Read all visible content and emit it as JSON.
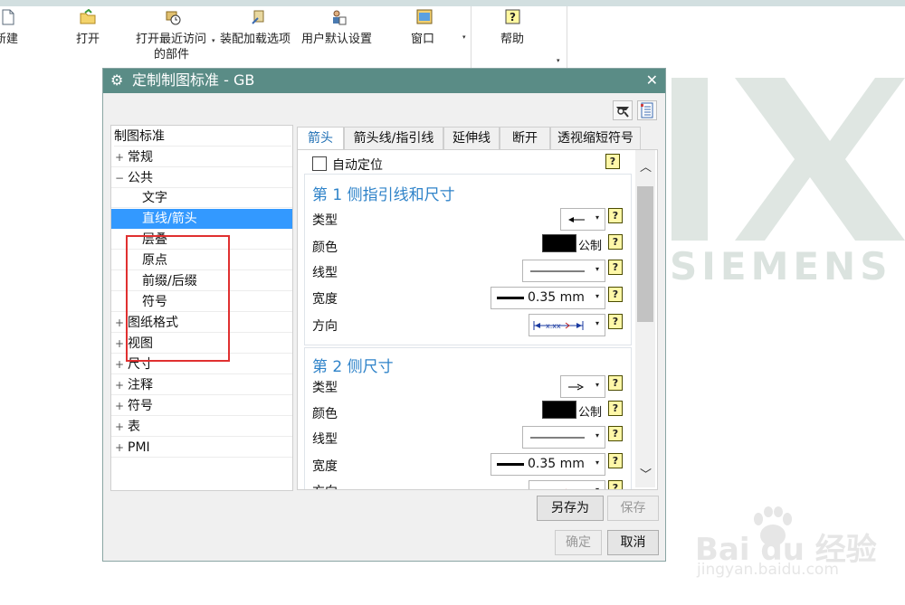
{
  "ribbon": {
    "items": [
      {
        "label": "新建",
        "icon": "new-file-icon"
      },
      {
        "label": "打开",
        "icon": "open-folder-icon"
      },
      {
        "label": "打开最近访问",
        "label2": "的部件",
        "icon": "recent-parts-icon"
      },
      {
        "label": "装配加载选项",
        "icon": "assembly-load-icon"
      },
      {
        "label": "用户默认设置",
        "icon": "user-defaults-icon"
      },
      {
        "label": "窗口",
        "icon": "window-icon"
      },
      {
        "label": "帮助",
        "icon": "help-icon"
      }
    ]
  },
  "dialog": {
    "title": "定制制图标准 - GB",
    "close": "✕",
    "tree": {
      "root": "制图标准",
      "items": [
        {
          "label": "常规",
          "plus": "+"
        },
        {
          "label": "公共",
          "plus": "−"
        },
        {
          "label": "文字",
          "plus": ""
        },
        {
          "label": "直线/箭头",
          "plus": ""
        },
        {
          "label": "层叠",
          "plus": ""
        },
        {
          "label": "原点",
          "plus": ""
        },
        {
          "label": "前缀/后缀",
          "plus": ""
        },
        {
          "label": "符号",
          "plus": ""
        },
        {
          "label": "图纸格式",
          "plus": "+"
        },
        {
          "label": "视图",
          "plus": "+"
        },
        {
          "label": "尺寸",
          "plus": "+"
        },
        {
          "label": "注释",
          "plus": "+"
        },
        {
          "label": "符号",
          "plus": "+"
        },
        {
          "label": "表",
          "plus": "+"
        },
        {
          "label": "PMI",
          "plus": "+"
        }
      ]
    },
    "tabs": [
      "箭头",
      "箭头线/指引线",
      "延伸线",
      "断开",
      "透视缩短符号"
    ],
    "panel": {
      "auto_position": "自动定位",
      "section1": {
        "title": "第 1 侧指引线和尺寸",
        "type_label": "类型",
        "color_label": "颜色",
        "color_value": "公制",
        "linetype_label": "线型",
        "width_label": "宽度",
        "width_value": "0.35 mm",
        "direction_label": "方向"
      },
      "section2": {
        "title": "第 2 侧尺寸",
        "type_label": "类型",
        "color_label": "颜色",
        "color_value": "公制",
        "linetype_label": "线型",
        "width_label": "宽度",
        "width_value": "0.35 mm",
        "direction_label": "方向"
      },
      "help_glyph": "?"
    },
    "buttons": {
      "save_as": "另存为",
      "save": "保存",
      "ok": "确定",
      "cancel": "取消"
    }
  },
  "watermark": {
    "brand": "SIEMENS",
    "baidu": "Bai du 经验",
    "baidu_url": "jingyan.baidu.com"
  },
  "colors": {
    "title_bar": "#5a8c86",
    "selection": "#3399ff",
    "section_title": "#2f83c9",
    "red_highlight": "#e03030"
  }
}
